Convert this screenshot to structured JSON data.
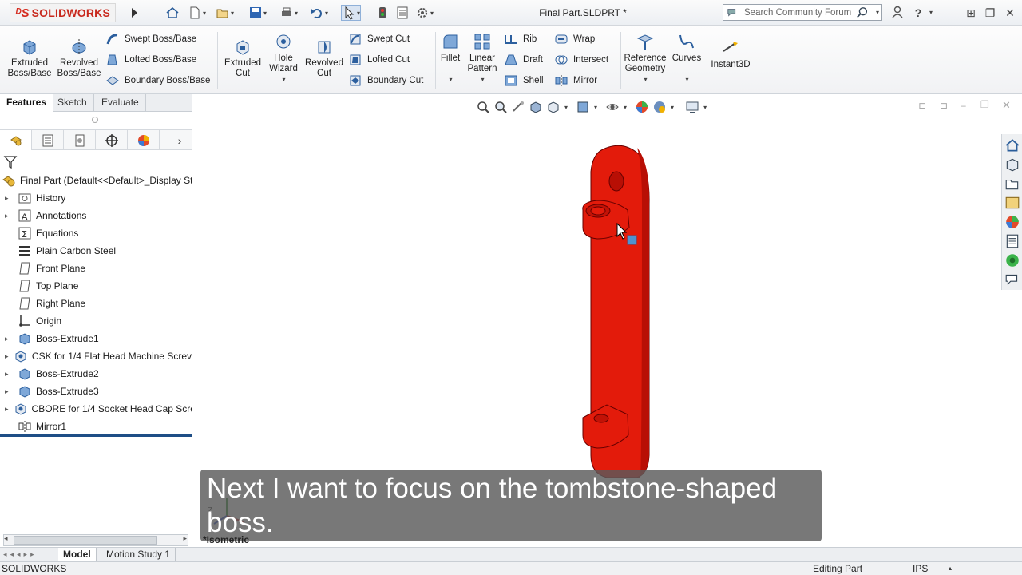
{
  "app": {
    "brand": "SOLIDWORKS",
    "document_title": "Final Part.SLDPRT *",
    "search_placeholder": "Search Community Forum"
  },
  "ribbon": {
    "extruded_boss": [
      "Extruded",
      "Boss/Base"
    ],
    "revolved_boss": [
      "Revolved",
      "Boss/Base"
    ],
    "swept_boss": "Swept Boss/Base",
    "lofted_boss": "Lofted Boss/Base",
    "boundary_boss": "Boundary Boss/Base",
    "extruded_cut": [
      "Extruded",
      "Cut"
    ],
    "hole_wizard": [
      "Hole",
      "Wizard"
    ],
    "revolved_cut": [
      "Revolved",
      "Cut"
    ],
    "swept_cut": "Swept Cut",
    "lofted_cut": "Lofted Cut",
    "boundary_cut": "Boundary Cut",
    "fillet": "Fillet",
    "linear_pattern": [
      "Linear",
      "Pattern"
    ],
    "rib": "Rib",
    "draft": "Draft",
    "shell": "Shell",
    "wrap": "Wrap",
    "intersect": "Intersect",
    "mirror": "Mirror",
    "reference_geometry": [
      "Reference",
      "Geometry"
    ],
    "curves": "Curves",
    "instant3d": "Instant3D"
  },
  "tabs": [
    "Features",
    "Sketch",
    "Evaluate"
  ],
  "tree": {
    "root": "Final Part  (Default<<Default>_Display St",
    "items": [
      {
        "label": "History",
        "expandable": true,
        "icon": "history-folder-icon"
      },
      {
        "label": "Annotations",
        "expandable": true,
        "icon": "annotations-icon"
      },
      {
        "label": "Equations",
        "expandable": false,
        "icon": "equations-icon"
      },
      {
        "label": "Plain Carbon Steel",
        "expandable": false,
        "icon": "material-icon"
      },
      {
        "label": "Front Plane",
        "expandable": false,
        "icon": "plane-icon"
      },
      {
        "label": "Top Plane",
        "expandable": false,
        "icon": "plane-icon"
      },
      {
        "label": "Right Plane",
        "expandable": false,
        "icon": "plane-icon"
      },
      {
        "label": "Origin",
        "expandable": false,
        "icon": "origin-icon"
      },
      {
        "label": "Boss-Extrude1",
        "expandable": true,
        "icon": "extrude-icon"
      },
      {
        "label": "CSK for 1/4 Flat Head Machine Screv",
        "expandable": true,
        "icon": "hole-icon"
      },
      {
        "label": "Boss-Extrude2",
        "expandable": true,
        "icon": "extrude-icon"
      },
      {
        "label": "Boss-Extrude3",
        "expandable": true,
        "icon": "extrude-icon"
      },
      {
        "label": "CBORE for 1/4 Socket Head Cap Scre",
        "expandable": true,
        "icon": "hole-icon"
      },
      {
        "label": "Mirror1",
        "expandable": false,
        "icon": "mirror-icon"
      }
    ]
  },
  "bottom_tabs": [
    "Model",
    "Motion Study 1"
  ],
  "status": {
    "app_name": "SOLIDWORKS",
    "mode": "Editing Part",
    "units": "IPS"
  },
  "viewport": {
    "view_label": "*Isometric",
    "caption": "Next I want to focus on the tombstone-shaped boss.",
    "part_color": "#e31b0b"
  }
}
